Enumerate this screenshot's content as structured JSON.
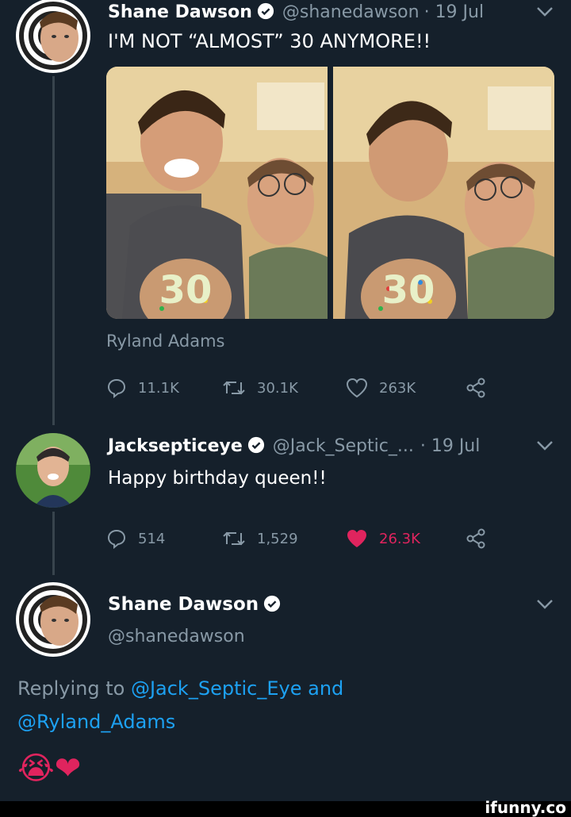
{
  "tweet1": {
    "name": "Shane Dawson",
    "handle": "@shanedawson",
    "date": "· 19 Jul",
    "text": "I'M NOT “ALMOST” 30 ANYMORE!!",
    "cake_text": "30",
    "tagged": "Ryland Adams",
    "replies": "11.1K",
    "retweets": "30.1K",
    "likes": "263K"
  },
  "tweet2": {
    "name": "Jacksepticeye",
    "handle": "@Jack_Septic_...",
    "date": "· 19 Jul",
    "text": "Happy birthday queen!!",
    "replies": "514",
    "retweets": "1,529",
    "likes": "26.3K",
    "liked": true
  },
  "tweet3": {
    "name": "Shane Dawson",
    "handle": "@shanedawson",
    "replying_prefix": "Replying to",
    "reply_user1": "@Jack_Septic_Eye",
    "reply_and": "and",
    "reply_user2": "@Ryland_Adams",
    "emoji": "😭❤"
  },
  "watermark": "ifunny.co",
  "colors": {
    "background": "#15202b",
    "secondary_text": "#8899a6",
    "link": "#1da1f2",
    "like": "#e0245e",
    "verified": "#ffffff"
  }
}
